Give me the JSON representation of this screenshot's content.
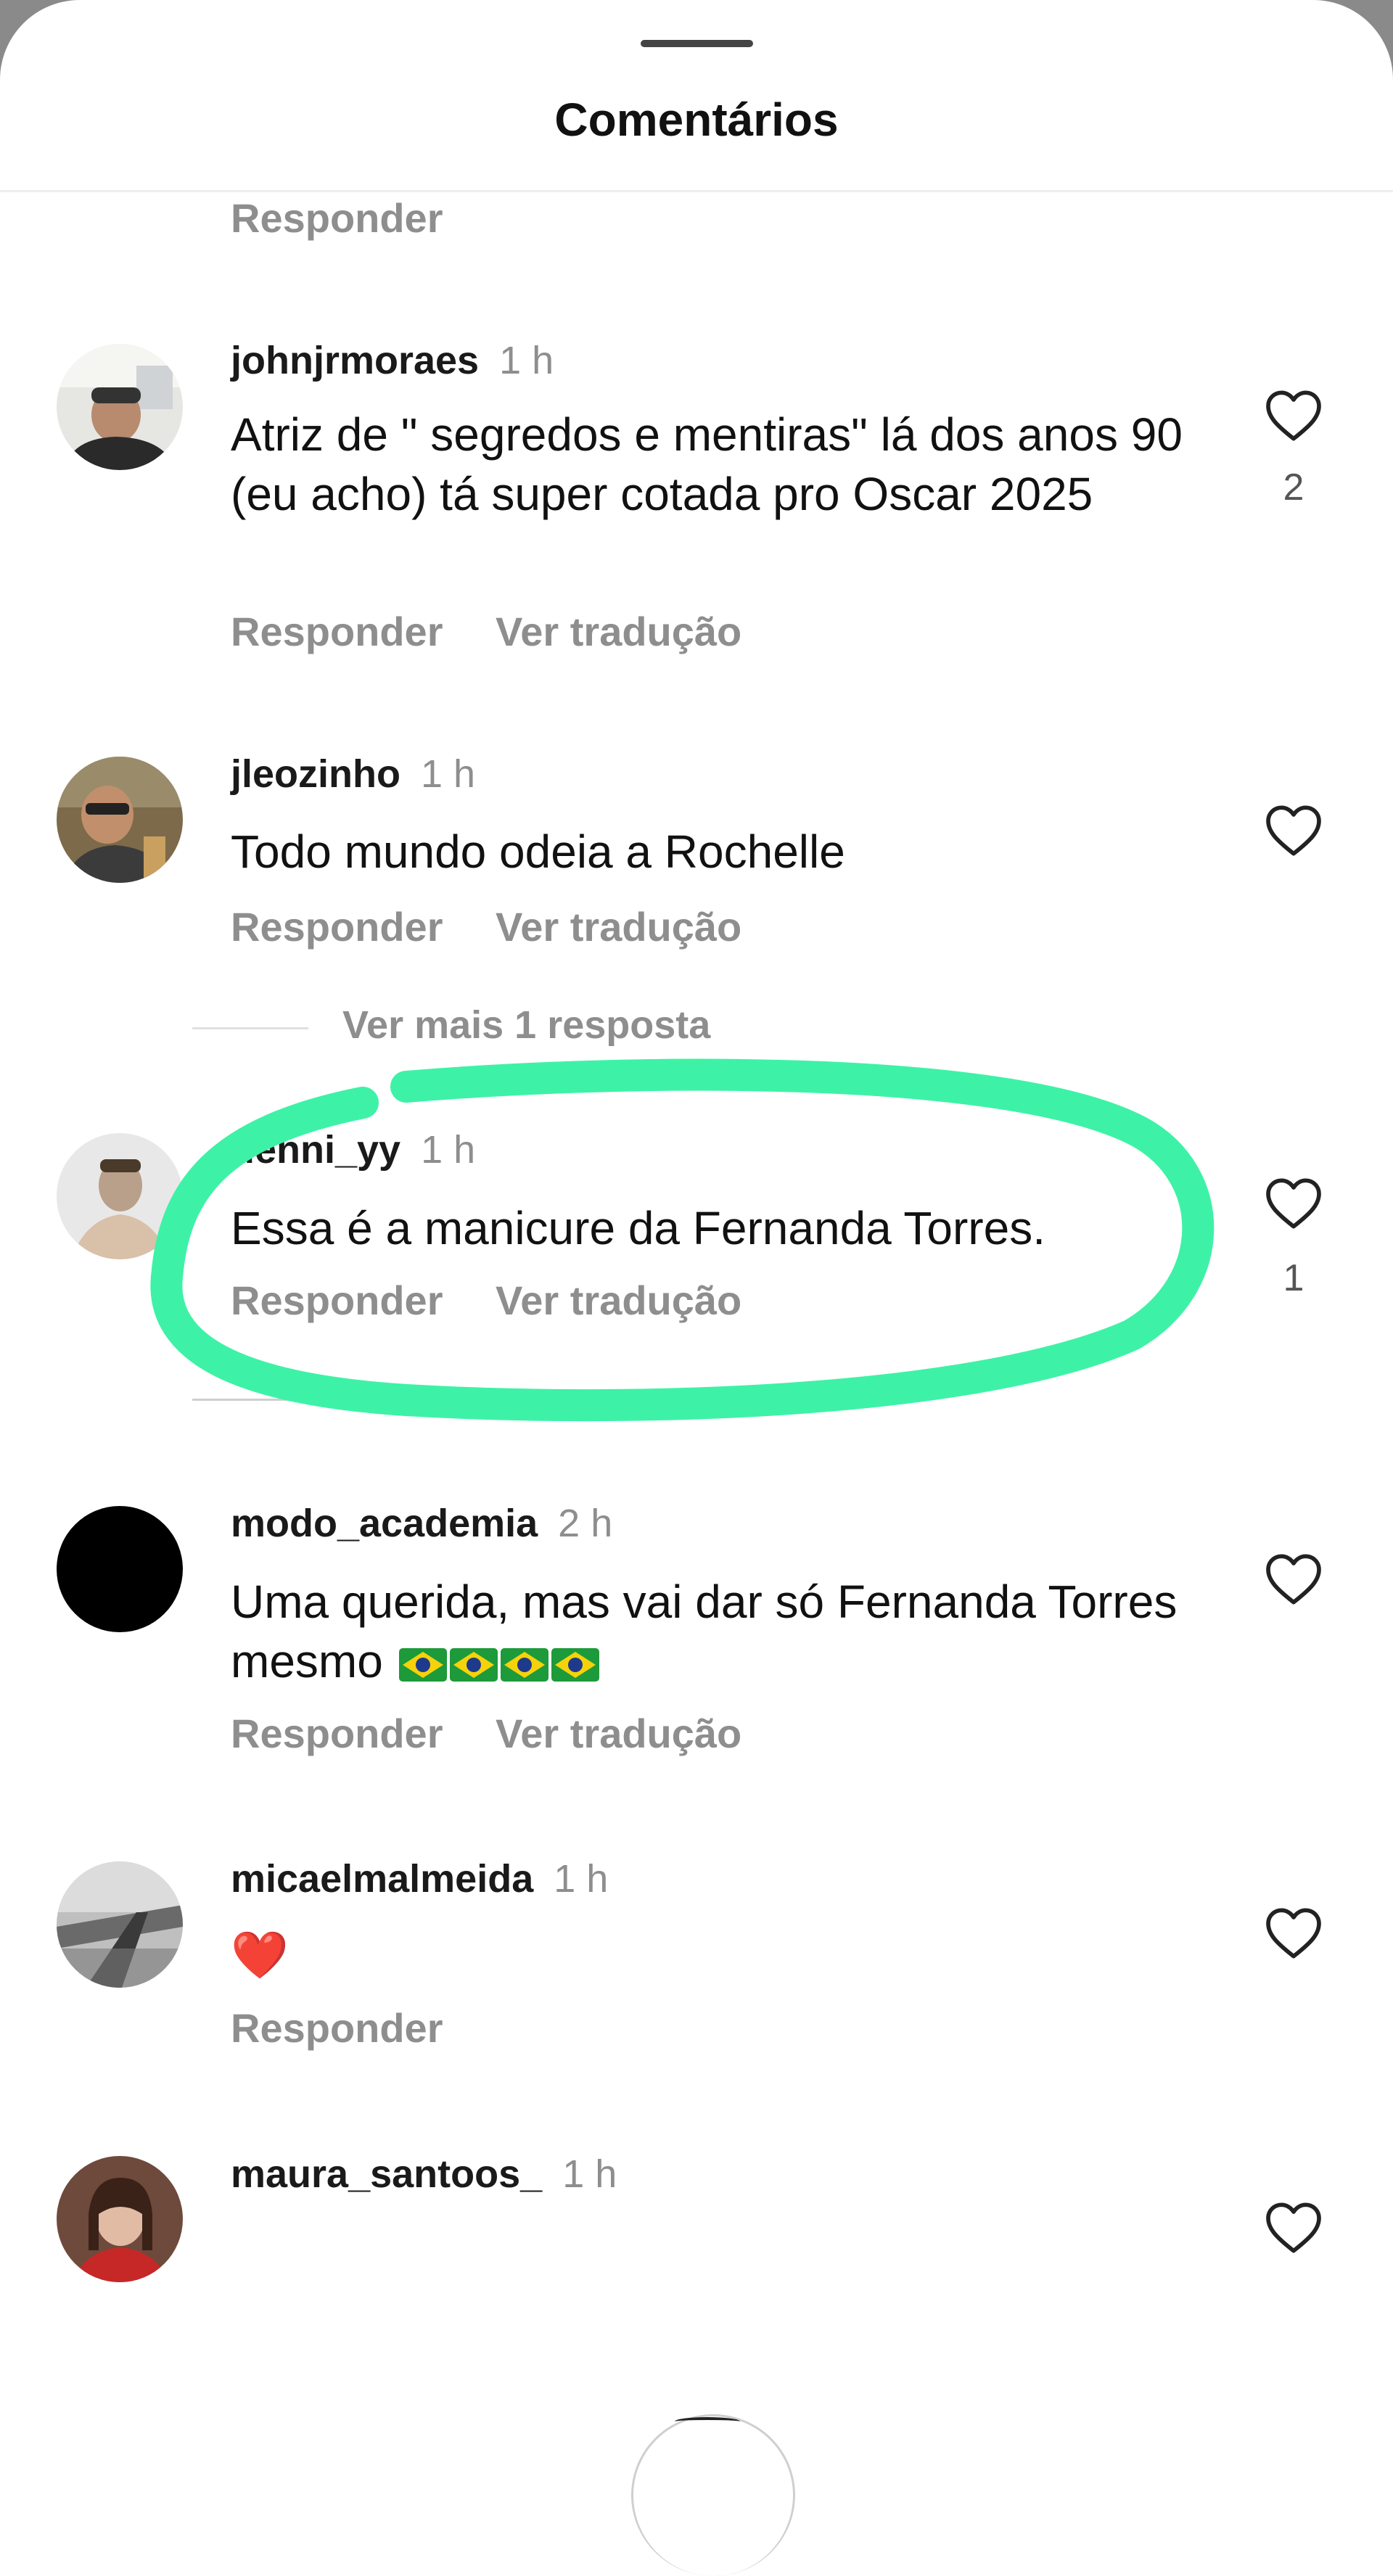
{
  "header": {
    "title": "Comentários"
  },
  "actions": {
    "reply": "Responder",
    "translate": "Ver tradução"
  },
  "top_partial": {
    "reply": "Responder"
  },
  "comments": [
    {
      "username": "johnjrmoraes",
      "time": "1 h",
      "text": "Atriz de \" segredos e mentiras\" lá dos anos 90 (eu acho) tá super cotada pro Oscar 2025",
      "likes": "2"
    },
    {
      "username": "jleozinho",
      "time": "1 h",
      "text": "Todo mundo odeia a Rochelle",
      "likes": ""
    },
    {
      "username": "uenni_yy",
      "time": "1 h",
      "text": "Essa é a manicure da Fernanda Torres.",
      "likes": "1"
    },
    {
      "username": "modo_academia",
      "time": "2 h",
      "text": "Uma querida, mas vai dar só Fernanda Torres mesmo",
      "likes": ""
    },
    {
      "username": "micaelmalmeida",
      "time": "1 h",
      "text": "❤️",
      "likes": ""
    },
    {
      "username": "maura_santoos_",
      "time": "1 h",
      "text": "",
      "likes": ""
    }
  ],
  "view_more": "Ver mais 1 resposta",
  "colors": {
    "highlight": "#3df2a6",
    "muted": "#8e8e8e",
    "text": "#111111"
  }
}
